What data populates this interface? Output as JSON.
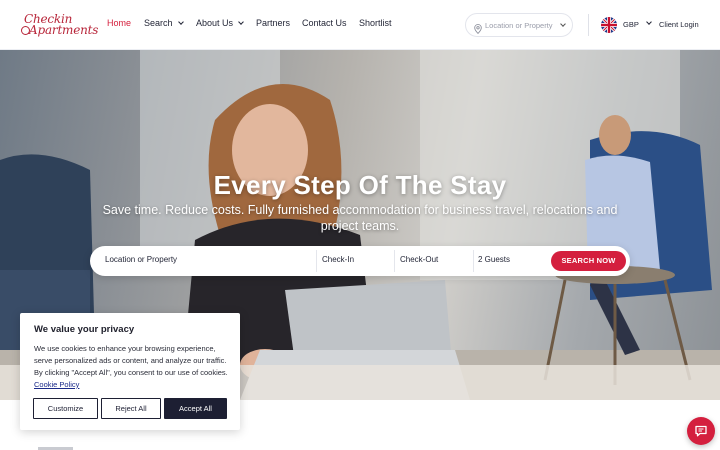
{
  "brand": {
    "logo_line1": "Checkin",
    "logo_line2": "Apartments"
  },
  "nav": {
    "items": [
      {
        "label": "Home",
        "active": true
      },
      {
        "label": "Search",
        "dropdown": true
      },
      {
        "label": "About Us",
        "dropdown": true
      },
      {
        "label": "Partners"
      },
      {
        "label": "Contact Us"
      },
      {
        "label": "Shortlist"
      }
    ]
  },
  "header": {
    "location_placeholder": "Location or Property",
    "currency": "GBP",
    "client_login": "Client Login"
  },
  "hero": {
    "title": "Every Step Of The Stay",
    "subtitle": "Save time. Reduce costs. Fully furnished accommodation for business travel, relocations and project teams."
  },
  "search": {
    "location_label": "Location or Property",
    "checkin_label": "Check-In",
    "checkout_label": "Check-Out",
    "guests_label": "2 Guests",
    "button_label": "SEARCH NOW"
  },
  "cookie": {
    "title": "We value your privacy",
    "body": "We use cookies to enhance your browsing experience, serve personalized ads or content, and analyze our traffic. By clicking \"Accept All\", you consent to our use of cookies.",
    "policy_link": "Cookie Policy",
    "customize_label": "Customize",
    "reject_label": "Reject All",
    "accept_label": "Accept All"
  },
  "colors": {
    "accent": "#d41f3e",
    "brand": "#b8263a",
    "dark": "#1d1f33"
  },
  "icons": {
    "location": "map-pin-icon",
    "flag": "uk-flag-icon",
    "chat": "chat-icon"
  }
}
